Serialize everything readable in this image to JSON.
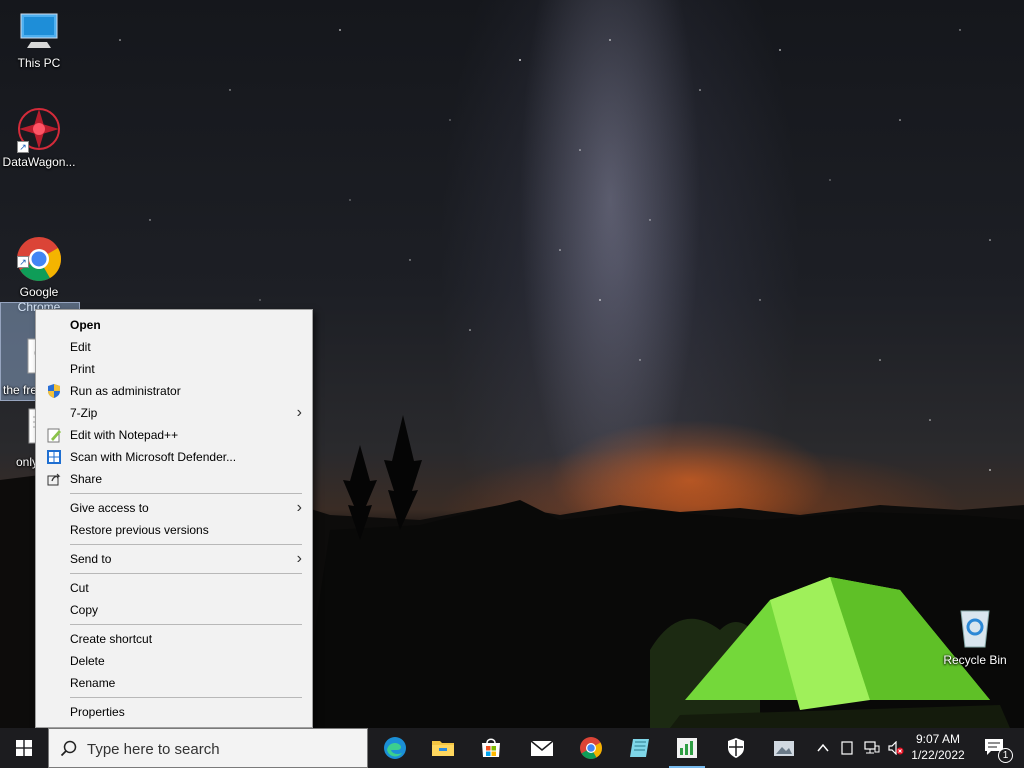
{
  "desktop": {
    "icons": [
      {
        "label": "This PC"
      },
      {
        "label": "DataWagon..."
      },
      {
        "label": "Google\nChrome"
      },
      {
        "label": "the fre\nplay a\nhack"
      },
      {
        "label": "only"
      },
      {
        "label": "Recycle Bin"
      }
    ]
  },
  "context_menu": {
    "items": [
      {
        "label": "Open"
      },
      {
        "label": "Edit"
      },
      {
        "label": "Print"
      },
      {
        "label": "Run as administrator",
        "icon": "uac-shield-icon"
      },
      {
        "label": "7-Zip"
      },
      {
        "label": "Edit with Notepad++",
        "icon": "notepad-plus-plus-icon"
      },
      {
        "label": "Scan with Microsoft Defender...",
        "icon": "defender-icon"
      },
      {
        "label": "Share",
        "icon": "share-icon"
      },
      {
        "label": "Give access to"
      },
      {
        "label": "Restore previous versions"
      },
      {
        "label": "Send to"
      },
      {
        "label": "Cut"
      },
      {
        "label": "Copy"
      },
      {
        "label": "Create shortcut"
      },
      {
        "label": "Delete"
      },
      {
        "label": "Rename"
      },
      {
        "label": "Properties"
      }
    ]
  },
  "taskbar": {
    "search_placeholder": "Type here to search",
    "apps": [
      "edge-icon",
      "file-explorer-icon",
      "store-icon",
      "mail-icon",
      "chrome-icon",
      "notebook-icon",
      "chart-app-icon",
      "shield-app-icon",
      "photo-app-icon"
    ],
    "clock": {
      "time": "9:07 AM",
      "date": "1/22/2022"
    },
    "notification_count": "1"
  },
  "colors": {
    "taskbar_bg": "#1c1c1f",
    "menu_bg": "#f2f2f2",
    "accent": "#76b9ed"
  }
}
